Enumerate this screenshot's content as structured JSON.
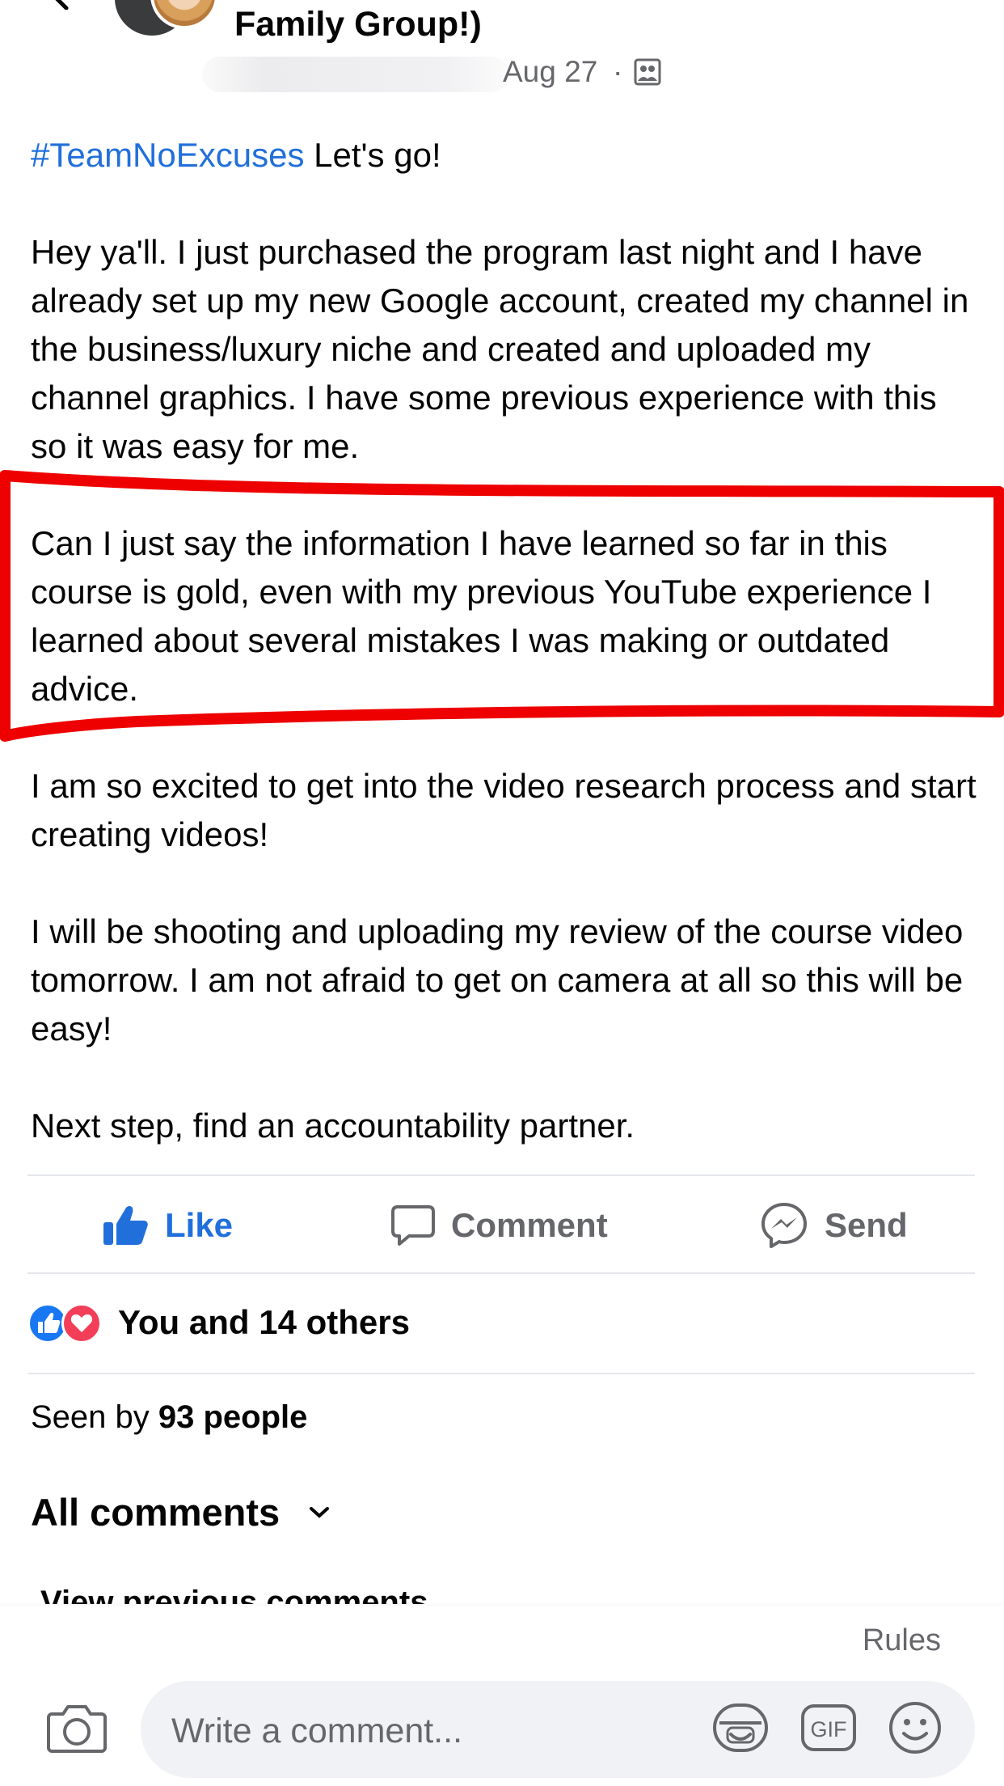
{
  "header": {
    "group_title": "Family Group!)",
    "post_date": "Aug 27",
    "date_separator": "·",
    "privacy_icon": "group-privacy-icon",
    "back_icon": "chevron-left-icon"
  },
  "post": {
    "hashtag": "#TeamNoExcuses",
    "line1_rest": " Let's go!",
    "paragraphs": [
      "Hey ya'll. I just purchased the program last night and I have already set up my new Google account, created my channel in the business/luxury niche and created and uploaded my channel graphics. I have some previous experience with this so it was easy for me.",
      "Can I just say the information I have learned so far in this course is gold, even with my previous YouTube experience I learned about several mistakes I was making or outdated advice.",
      "I am so excited to get into the video research process and start creating videos!",
      "I will be shooting and uploading my review of the course video tomorrow. I am not afraid to get on camera at all so this will be easy!",
      "Next step, find an accountability partner."
    ],
    "highlight_color": "#ee0000"
  },
  "actions": {
    "like_label": "Like",
    "comment_label": "Comment",
    "send_label": "Send"
  },
  "reactions": {
    "summary": "You and 14 others",
    "icons": [
      "like-reaction-icon",
      "love-reaction-icon"
    ]
  },
  "seen": {
    "prefix": "Seen by ",
    "count_text": "93 people"
  },
  "comments": {
    "filter_label": "All comments",
    "view_previous": "View previous comments"
  },
  "composer": {
    "rules_label": "Rules",
    "placeholder": "Write a comment...",
    "gif_label": "GIF"
  },
  "colors": {
    "accent_blue": "#216fdb",
    "secondary_text": "#65676b",
    "love_red": "#f33e58",
    "like_blue": "#1877f2"
  }
}
